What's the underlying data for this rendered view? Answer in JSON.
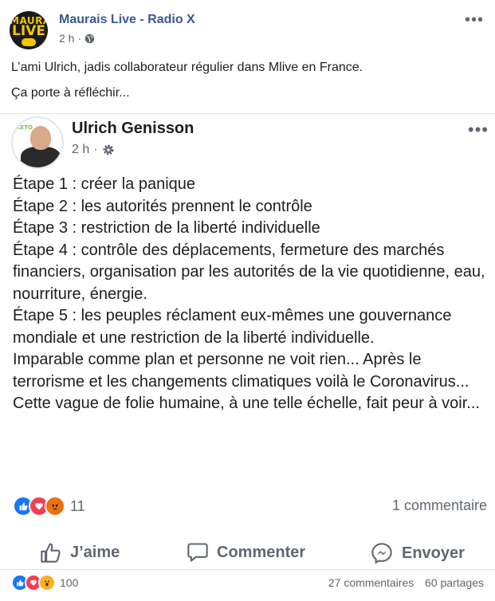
{
  "page": {
    "name": "Maurais Live - Radio X",
    "time": "2 h",
    "avatar_text_top": "MAURAIS",
    "avatar_text_main": "LIVE"
  },
  "post": {
    "line1": "L’ami Ulrich, jadis collaborateur régulier dans Mlive en France.",
    "line2": "Ça porte à réfléchir..."
  },
  "shared": {
    "author": "Ulrich Genisson",
    "time": "2 h",
    "avatar_badge": "KETO",
    "text": "Étape 1 : créer la panique\nÉtape 2 : les autorités prennent le contrôle\nÉtape 3 : restriction de la liberté individuelle\nÉtape 4 : contrôle des déplacements, fermeture des marchés financiers, organisation par les autorités de la vie quotidienne, eau, nourriture, énergie.\nÉtape 5 : les peuples réclament eux-mêmes une gouvernance mondiale et une restriction de la liberté individuelle.\nImparable comme plan et personne ne voit rien... Après le terrorisme et les changements climatiques voilà le Coronavirus...\nCette vague de folie humaine, à une telle échelle, fait peur à voir...",
    "reaction_count": "11",
    "comment_count": "1 commentaire",
    "actions": {
      "like": "J’aime",
      "comment": "Commenter",
      "send": "Envoyer"
    }
  },
  "footer": {
    "reaction_count": "100",
    "comments": "27 commentaires",
    "shares": "60 partages"
  },
  "colors": {
    "link_blue": "#385898",
    "like_blue": "#1877f2",
    "love_red": "#f33e58",
    "angry_orange": "#e9710f",
    "wow_yellow": "#f7b125"
  }
}
